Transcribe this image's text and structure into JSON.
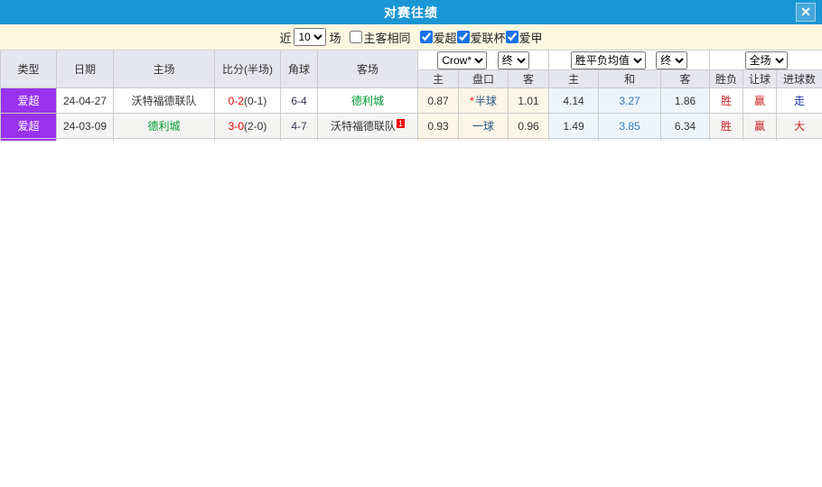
{
  "dialog": {
    "title": "对赛往绩",
    "close_glyph": "✕"
  },
  "filterbar": {
    "recent_label": "近",
    "recent_value": "10",
    "matches_label": "场",
    "same_venue": {
      "label": "主客相同",
      "checked": false
    },
    "leagues": [
      {
        "label": "爱超",
        "checked": true
      },
      {
        "label": "爱联杯",
        "checked": true
      },
      {
        "label": "爱甲",
        "checked": true
      }
    ]
  },
  "table": {
    "selects": {
      "bookmaker": "Crow*",
      "ah_final": "终",
      "eu_metric": "胜平负均值",
      "eu_final": "终",
      "scope": "全场"
    },
    "columns": {
      "type": "类型",
      "date": "日期",
      "home": "主场",
      "score": "比分(半场)",
      "corners": "角球",
      "away": "客场",
      "ah_home": "主",
      "ah_line": "盘口",
      "ah_away": "客",
      "eu_home": "主",
      "eu_draw": "和",
      "eu_away": "客",
      "wdl": "胜负",
      "handicap": "让球",
      "goals": "进球数"
    },
    "rows": [
      {
        "league": "爱超",
        "date": "24-04-27",
        "home": "沃特福德联队",
        "home_color": "black",
        "score": "0-2",
        "half": "(0-1)",
        "corners": "6-4",
        "away": "德利城",
        "away_color": "green",
        "away_badge": "",
        "ah_home": "0.87",
        "ah_line_star": "*",
        "ah_line": "半球",
        "ah_away": "1.01",
        "eu_home": "4.14",
        "eu_draw": "3.27",
        "eu_away": "1.86",
        "result_wdl": "胜",
        "result_ah": "赢",
        "result_ou": "走",
        "result_ou_color": "blue"
      },
      {
        "league": "爱超",
        "date": "24-03-09",
        "home": "德利城",
        "home_color": "green",
        "score": "3-0",
        "half": "(2-0)",
        "corners": "4-7",
        "away": "沃特福德联队",
        "away_color": "black",
        "away_badge": "1",
        "ah_home": "0.93",
        "ah_line_star": "",
        "ah_line": "一球",
        "ah_away": "0.96",
        "eu_home": "1.49",
        "eu_draw": "3.85",
        "eu_away": "6.34",
        "result_wdl": "胜",
        "result_ah": "赢",
        "result_ou": "大",
        "result_ou_color": "red"
      }
    ]
  },
  "colors": {
    "titlebar_bg": "#1A96D5",
    "filterbar_bg": "#FDF7E2",
    "header_bg": "#E6E6F0",
    "league_badge_bg": "#9933EE",
    "score_red": "#EE0000",
    "team_green": "#009933",
    "draw_odds_blue": "#3377BB",
    "result_red": "#CC2222",
    "result_blue": "#2233BB",
    "ah_column_bg": "#FBF6E7",
    "eu_column_bg": "#EDF5FA"
  }
}
